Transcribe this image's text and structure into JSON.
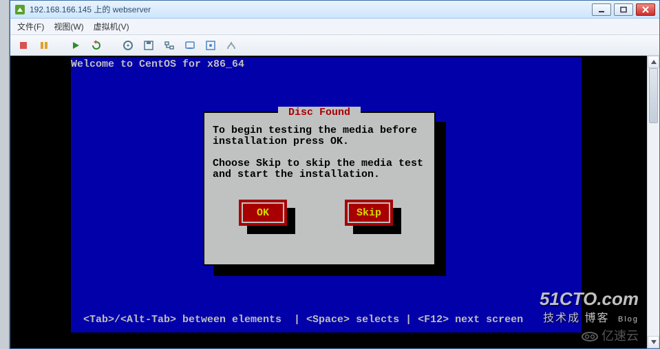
{
  "window": {
    "title": "192.168.166.145 上的 webserver"
  },
  "menu": {
    "file": "文件(F)",
    "view": "视图(W)",
    "vm": "虚拟机(V)"
  },
  "toolbar": {
    "stop": "stop-icon",
    "pause": "pause-icon",
    "play": "play-icon",
    "refresh": "refresh-icon",
    "cd": "cd-icon",
    "floppy": "floppy-icon",
    "network": "network-icon",
    "snapshot": "snapshot-icon",
    "fullscreen": "fullscreen-icon",
    "settings": "settings-icon"
  },
  "console": {
    "welcome": "Welcome to CentOS for x86_64",
    "footer": "<Tab>/<Alt-Tab> between elements  | <Space> selects | <F12> next screen"
  },
  "dialog": {
    "title": " Disc Found ",
    "line1": "To begin testing the media before",
    "line2": "installation press OK.",
    "line3": "",
    "line4": "Choose Skip to skip the media test",
    "line5": "and start the installation.",
    "ok": "OK",
    "skip": "Skip"
  },
  "watermark": {
    "w1": "51CTO.com",
    "w2": "技术成   博客",
    "w3": "Blog",
    "w4": "亿速云"
  }
}
